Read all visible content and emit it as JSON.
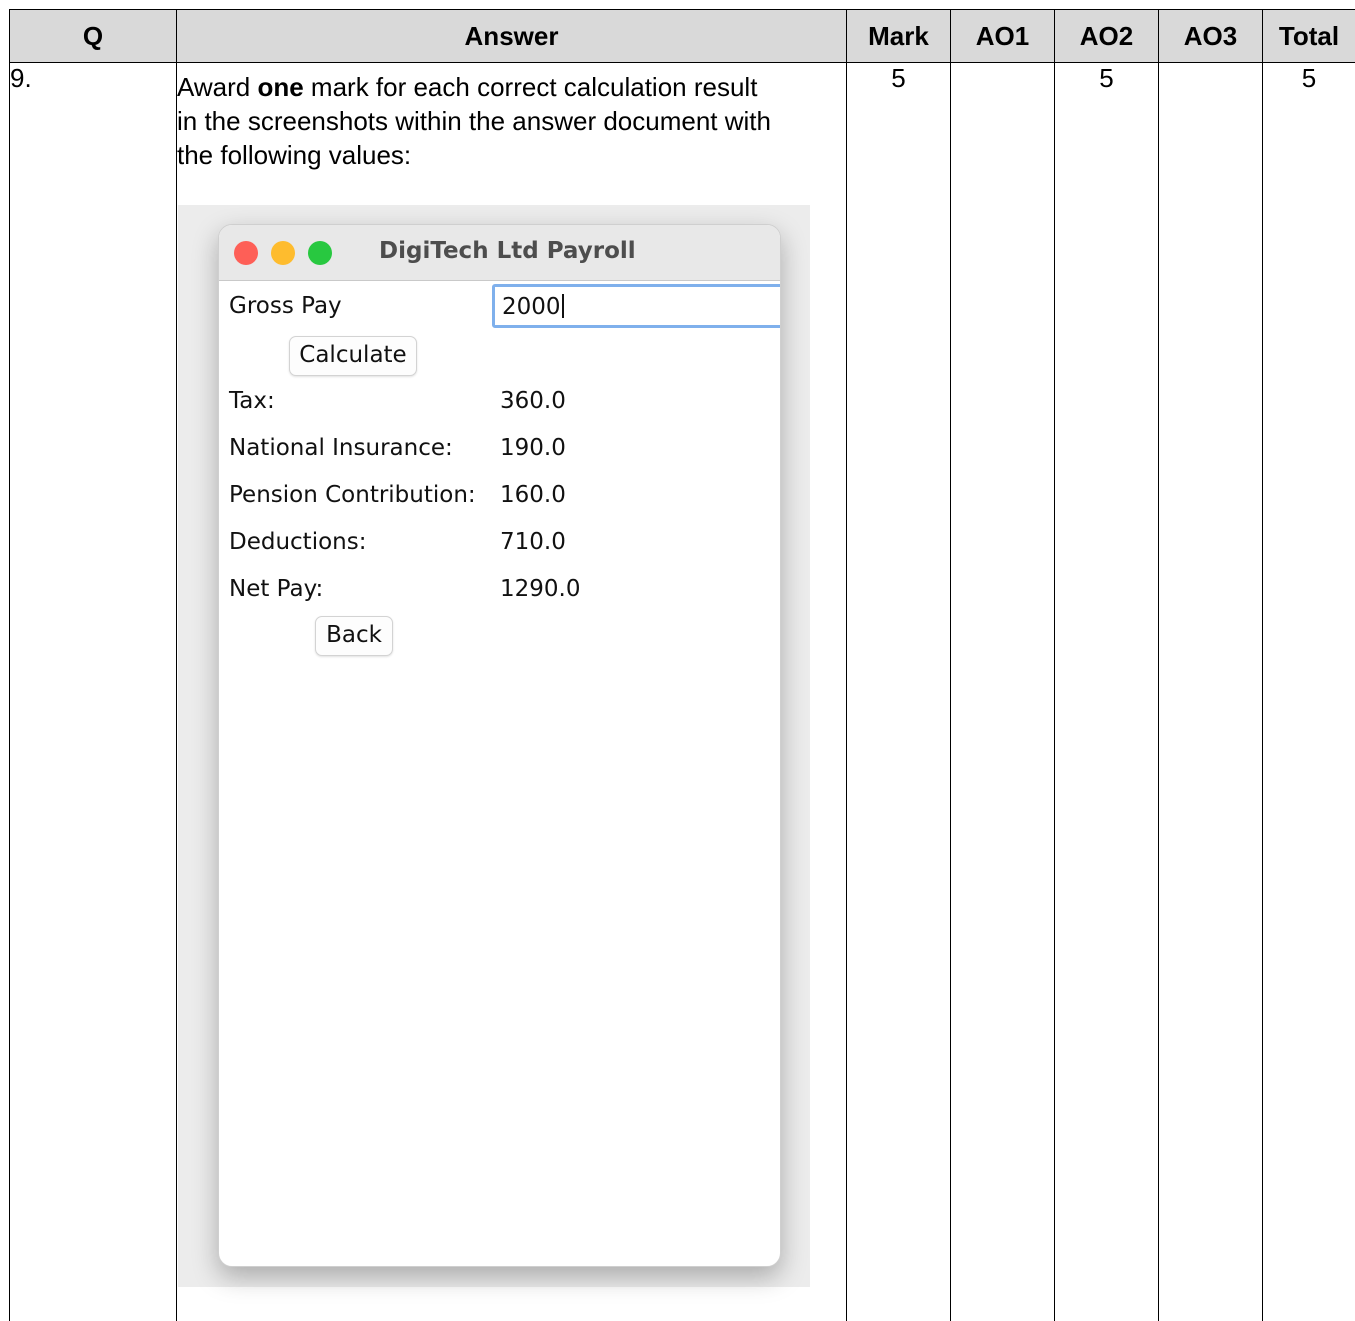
{
  "table": {
    "headers": [
      "Q",
      "Answer",
      "Mark",
      "AO1",
      "AO2",
      "AO3",
      "Total"
    ],
    "row": {
      "q": "9.",
      "answer_prefix": "Award ",
      "answer_bold": "one",
      "answer_suffix": " mark for each correct calculation result in the screenshots within the answer document with the following values:",
      "mark": "5",
      "ao1": "",
      "ao2": "5",
      "ao3": "",
      "total": "5"
    }
  },
  "payroll_window": {
    "title": "DigiTech Ltd Payroll",
    "gross_pay_label": "Gross Pay",
    "gross_pay_value": "2000",
    "calculate_button": "Calculate",
    "results": [
      {
        "label": "Tax:",
        "value": "360.0"
      },
      {
        "label": "National Insurance:",
        "value": "190.0"
      },
      {
        "label": "Pension Contribution:",
        "value": "160.0"
      },
      {
        "label": "Deductions:",
        "value": "710.0"
      },
      {
        "label": "Net Pay:",
        "value": "1290.0"
      }
    ],
    "back_button": "Back",
    "traffic_light_colors": {
      "close": "#fe5f57",
      "minimize": "#febc2e",
      "zoom": "#28c840"
    }
  }
}
